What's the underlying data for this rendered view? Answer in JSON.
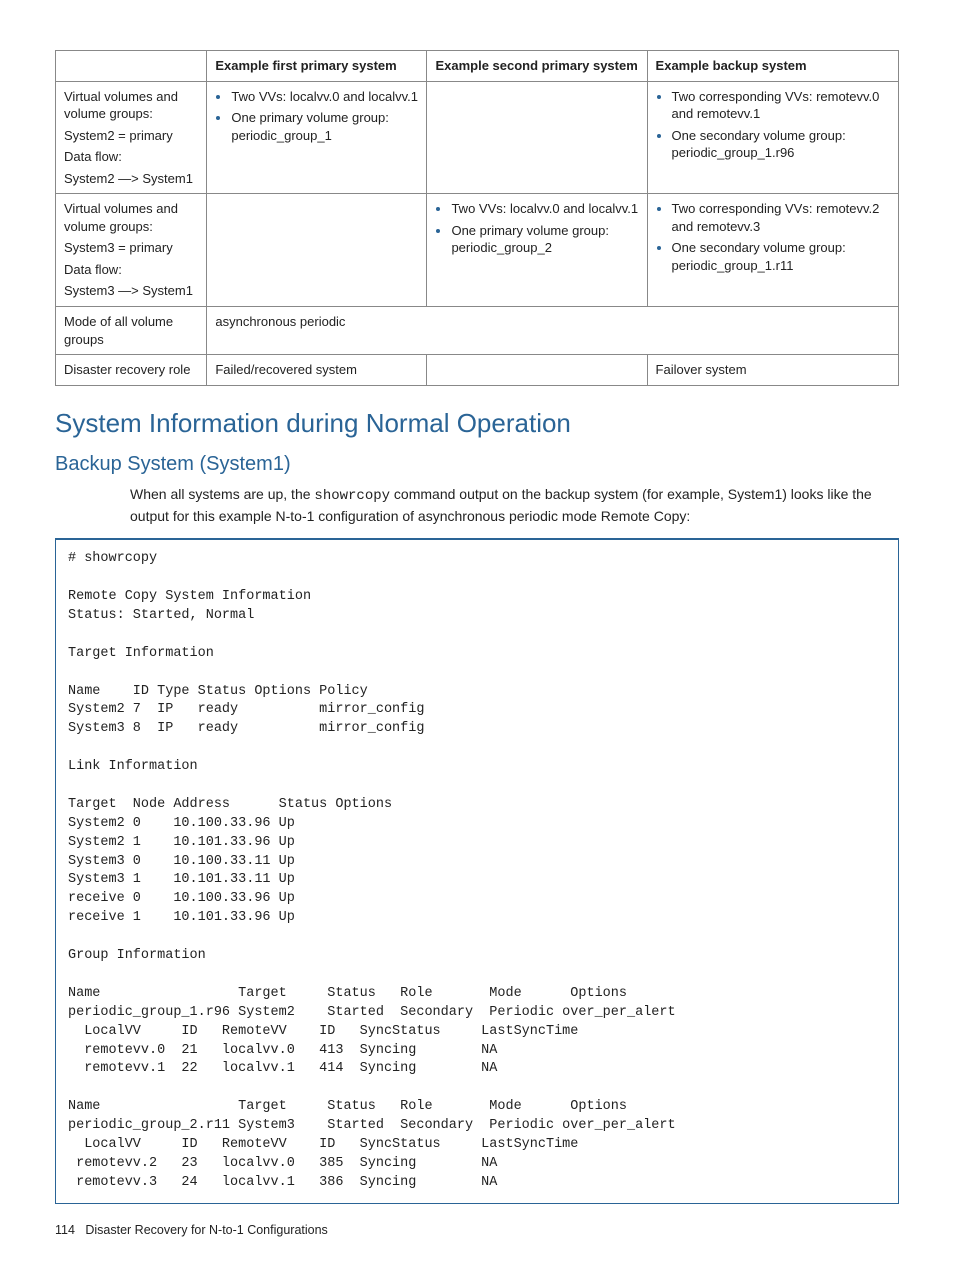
{
  "table": {
    "headers": [
      "",
      "Example first primary system",
      "Example second primary system",
      "Example backup system"
    ],
    "rows": [
      {
        "label_lines": [
          "Virtual volumes and volume groups:",
          "System2 = primary",
          "Data flow:",
          "System2 —> System1"
        ],
        "col1_items": [
          "Two VVs: localvv.0 and localvv.1",
          "One primary volume group: periodic_group_1"
        ],
        "col2_items": [],
        "col3_items": [
          "Two corresponding VVs: remotevv.0 and remotevv.1",
          "One secondary volume group: periodic_group_1.r96"
        ]
      },
      {
        "label_lines": [
          "Virtual volumes and volume groups:",
          "System3 = primary",
          "Data flow:",
          "System3 —> System1"
        ],
        "col1_items": [],
        "col2_items": [
          "Two VVs: localvv.0 and localvv.1",
          "One primary volume group: periodic_group_2"
        ],
        "col3_items": [
          "Two corresponding VVs: remotevv.2 and remotevv.3",
          "One secondary volume group: periodic_group_1.r11"
        ]
      },
      {
        "label": "Mode of all volume groups",
        "merged": "asynchronous periodic"
      },
      {
        "label": "Disaster recovery role",
        "col1": "Failed/recovered system",
        "col2": "",
        "col3": "Failover system"
      }
    ]
  },
  "headings": {
    "h1": "System Information during Normal Operation",
    "h2": "Backup System (System1)"
  },
  "paragraph": {
    "pre": "When all systems are up, the ",
    "code": "showrcopy",
    "post": " command output on the backup system (for example, System1) looks like the output for this example N-to-1 configuration of asynchronous periodic mode Remote Copy:"
  },
  "codeblock": "# showrcopy\n\nRemote Copy System Information\nStatus: Started, Normal\n\nTarget Information\n\nName    ID Type Status Options Policy\nSystem2 7  IP   ready          mirror_config\nSystem3 8  IP   ready          mirror_config\n\nLink Information\n\nTarget  Node Address      Status Options\nSystem2 0    10.100.33.96 Up\nSystem2 1    10.101.33.96 Up\nSystem3 0    10.100.33.11 Up\nSystem3 1    10.101.33.11 Up\nreceive 0    10.100.33.96 Up\nreceive 1    10.101.33.96 Up\n\nGroup Information\n\nName                 Target     Status   Role       Mode      Options\nperiodic_group_1.r96 System2    Started  Secondary  Periodic over_per_alert\n  LocalVV     ID   RemoteVV    ID   SyncStatus     LastSyncTime\n  remotevv.0  21   localvv.0   413  Syncing        NA\n  remotevv.1  22   localvv.1   414  Syncing        NA\n\nName                 Target     Status   Role       Mode      Options\nperiodic_group_2.r11 System3    Started  Secondary  Periodic over_per_alert\n  LocalVV     ID   RemoteVV    ID   SyncStatus     LastSyncTime\n remotevv.2   23   localvv.0   385  Syncing        NA\n remotevv.3   24   localvv.1   386  Syncing        NA",
  "footer": {
    "page": "114",
    "title": "Disaster Recovery for N-to-1 Configurations"
  }
}
